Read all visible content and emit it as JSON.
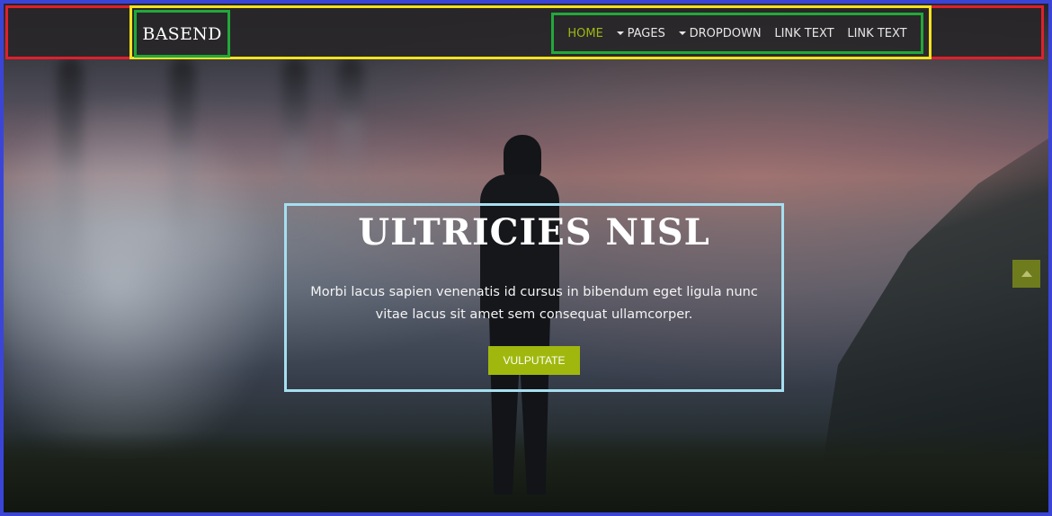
{
  "header": {
    "brand": "BASEND",
    "menu": [
      {
        "label": "HOME",
        "active": true,
        "dropdown": false
      },
      {
        "label": "PAGES",
        "active": false,
        "dropdown": true
      },
      {
        "label": "DROPDOWN",
        "active": false,
        "dropdown": true
      },
      {
        "label": "LINK TEXT",
        "active": false,
        "dropdown": false
      },
      {
        "label": "LINK TEXT",
        "active": false,
        "dropdown": false
      }
    ]
  },
  "hero": {
    "title": "ULTRICIES NISL",
    "text": "Morbi lacus sapien venenatis id cursus in bibendum eget ligula nunc vitae lacus sit amet sem consequat ullamcorper.",
    "button_label": "VULPUTATE"
  },
  "scroll_top_icon": "chevron-up-icon",
  "colors": {
    "accent": "#a0b80e",
    "active_link": "#9fb813",
    "outline_page": "#3a45d8",
    "outline_header": "#e0202a",
    "outline_container": "#f4e21e",
    "outline_nav": "#22a83a",
    "outline_hero": "#a5dff0"
  }
}
